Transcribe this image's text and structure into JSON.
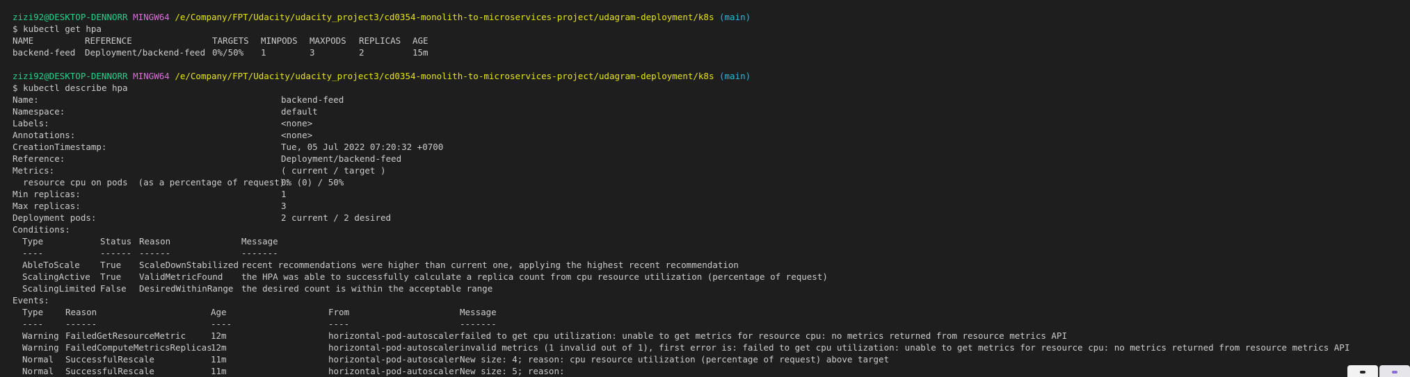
{
  "prompt": {
    "user_host": "zizi92@DESKTOP-DENNORR",
    "system": "MINGW64",
    "path": "/e/Company/FPT/Udacity/udacity_project3/cd0354-monolith-to-microservices-project/udagram-deployment/k8s",
    "branch": "(main)",
    "symbol": "$"
  },
  "commands": {
    "get_hpa": "kubectl get hpa",
    "describe_hpa": "kubectl describe hpa"
  },
  "hpa_table": {
    "headers": [
      "NAME",
      "REFERENCE",
      "TARGETS",
      "MINPODS",
      "MAXPODS",
      "REPLICAS",
      "AGE"
    ],
    "rows": [
      [
        "backend-feed",
        "Deployment/backend-feed",
        "0%/50%",
        "1",
        "3",
        "2",
        "15m"
      ]
    ]
  },
  "describe": [
    {
      "label": "Name:",
      "value": "backend-feed"
    },
    {
      "label": "Namespace:",
      "value": "default"
    },
    {
      "label": "Labels:",
      "value": "<none>"
    },
    {
      "label": "Annotations:",
      "value": "<none>"
    },
    {
      "label": "CreationTimestamp:",
      "value": "Tue, 05 Jul 2022 07:20:32 +0700"
    },
    {
      "label": "Reference:",
      "value": "Deployment/backend-feed"
    },
    {
      "label": "Metrics:",
      "value": "( current / target )"
    },
    {
      "label": "  resource cpu on pods  (as a percentage of request):",
      "value": "0% (0) / 50%"
    },
    {
      "label": "Min replicas:",
      "value": "1"
    },
    {
      "label": "Max replicas:",
      "value": "3"
    },
    {
      "label": "Deployment pods:",
      "value": "2 current / 2 desired"
    }
  ],
  "conditions": {
    "title": "Conditions:",
    "headers": [
      "Type",
      "Status",
      "Reason",
      "Message"
    ],
    "dashes": [
      "----",
      "------",
      "------",
      "-------"
    ],
    "rows": [
      [
        "AbleToScale",
        "True",
        "ScaleDownStabilized",
        "recent recommendations were higher than current one, applying the highest recent recommendation"
      ],
      [
        "ScalingActive",
        "True",
        "ValidMetricFound",
        "the HPA was able to successfully calculate a replica count from cpu resource utilization (percentage of request)"
      ],
      [
        "ScalingLimited",
        "False",
        "DesiredWithinRange",
        "the desired count is within the acceptable range"
      ]
    ]
  },
  "events": {
    "title": "Events:",
    "headers": [
      "Type",
      "Reason",
      "Age",
      "From",
      "Message"
    ],
    "dashes": [
      "----",
      "------",
      "----",
      "----",
      "-------"
    ],
    "rows": [
      [
        "Warning",
        "FailedGetResourceMetric",
        "12m",
        "horizontal-pod-autoscaler",
        "failed to get cpu utilization: unable to get metrics for resource cpu: no metrics returned from resource metrics API"
      ],
      [
        "Warning",
        "FailedComputeMetricsReplicas",
        "12m",
        "horizontal-pod-autoscaler",
        "invalid metrics (1 invalid out of 1), first error is: failed to get cpu utilization: unable to get metrics for resource cpu: no metrics returned from resource metrics API"
      ],
      [
        "Normal",
        "SuccessfulRescale",
        "11m",
        "horizontal-pod-autoscaler",
        "New size: 4; reason: cpu resource utilization (percentage of request) above target"
      ],
      [
        "Normal",
        "SuccessfulRescale",
        "11m",
        "horizontal-pod-autoscaler",
        "New size: 5; reason:"
      ]
    ]
  }
}
